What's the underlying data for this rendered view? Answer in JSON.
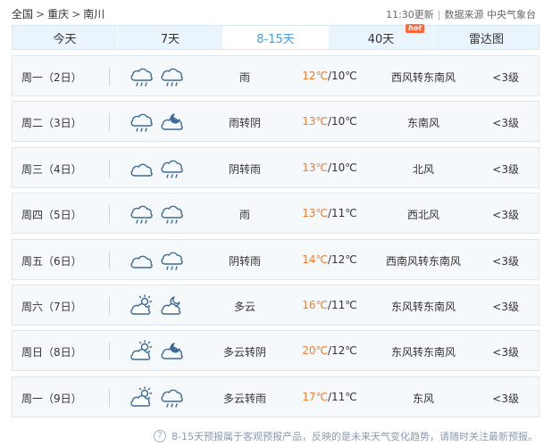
{
  "breadcrumb": {
    "items": [
      "全国",
      "重庆",
      "南川"
    ],
    "separator": ">"
  },
  "header": {
    "update_time": "11:30更新",
    "source": "数据来源 中央气象台"
  },
  "tabs": [
    {
      "label": "今天",
      "active": false
    },
    {
      "label": "7天",
      "active": false
    },
    {
      "label": "8-15天",
      "active": true
    },
    {
      "label": "40天",
      "active": false,
      "badge": "hot"
    },
    {
      "label": "雷达图",
      "active": false
    }
  ],
  "days": [
    {
      "date": "周一（2日）",
      "icon1": "rain-cloud-icon",
      "icon2": "rain-cloud-icon",
      "condition": "雨",
      "high": "12℃",
      "low": "/10℃",
      "wind": "西风转东南风",
      "level": "<3级"
    },
    {
      "date": "周二（3日）",
      "icon1": "rain-cloud-icon",
      "icon2": "overcast-night-icon",
      "condition": "雨转阴",
      "high": "13℃",
      "low": "/10℃",
      "wind": "东南风",
      "level": "<3级"
    },
    {
      "date": "周三（4日）",
      "icon1": "overcast-cloud-icon",
      "icon2": "rain-cloud-icon",
      "condition": "阴转雨",
      "high": "13℃",
      "low": "/10℃",
      "wind": "北风",
      "level": "<3级"
    },
    {
      "date": "周四（5日）",
      "icon1": "rain-cloud-icon",
      "icon2": "rain-cloud-icon",
      "condition": "雨",
      "high": "13℃",
      "low": "/11℃",
      "wind": "西北风",
      "level": "<3级"
    },
    {
      "date": "周五（6日）",
      "icon1": "overcast-cloud-icon",
      "icon2": "rain-cloud-icon",
      "condition": "阴转雨",
      "high": "14℃",
      "low": "/12℃",
      "wind": "西南风转东南风",
      "level": "<3级"
    },
    {
      "date": "周六（7日）",
      "icon1": "partly-cloudy-sun-icon",
      "icon2": "partly-cloudy-moon-icon",
      "condition": "多云",
      "high": "16℃",
      "low": "/11℃",
      "wind": "东风转东南风",
      "level": "<3级"
    },
    {
      "date": "周日（8日）",
      "icon1": "partly-cloudy-sun-icon",
      "icon2": "overcast-night-icon",
      "condition": "多云转阴",
      "high": "20℃",
      "low": "/12℃",
      "wind": "东风转东南风",
      "level": "<3级"
    },
    {
      "date": "周一（9日）",
      "icon1": "partly-cloudy-sun-icon",
      "icon2": "rain-cloud-icon",
      "condition": "多云转雨",
      "high": "17℃",
      "low": "/11℃",
      "wind": "东风",
      "level": "<3级"
    }
  ],
  "footer": {
    "note": "8-15天预报属于客观预报产品，反映的是未来天气变化趋势，请随时关注最新预报。",
    "help_icon": "?"
  }
}
